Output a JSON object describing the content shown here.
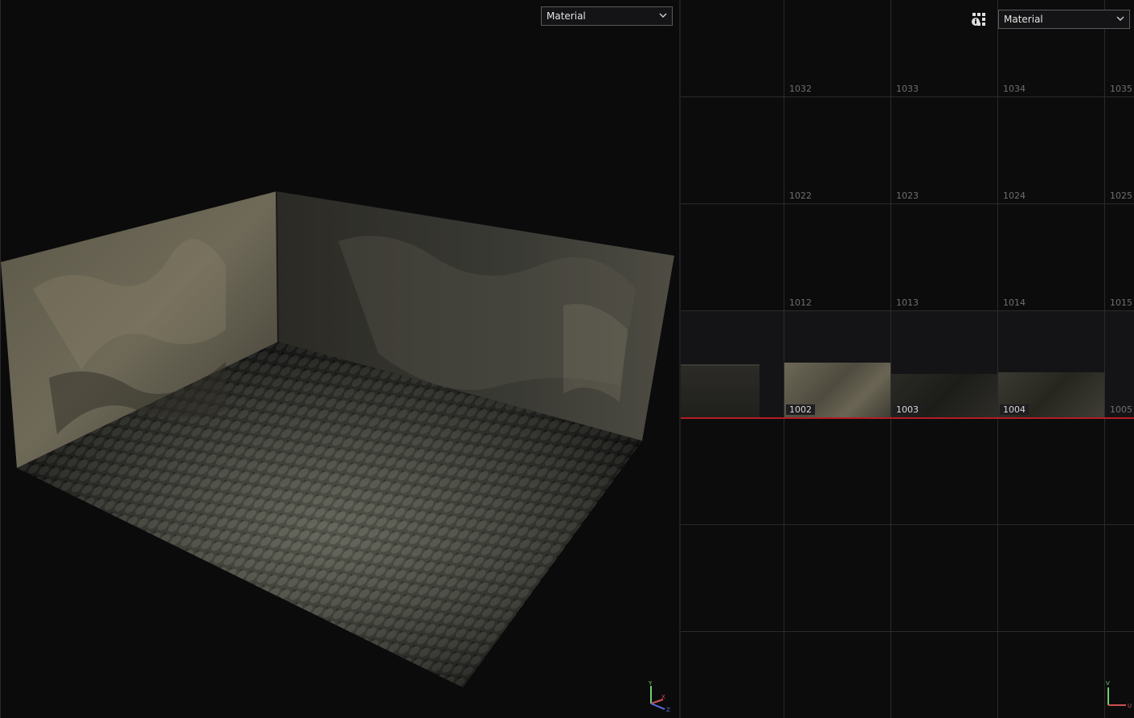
{
  "viewport3d": {
    "dropdown": {
      "selected": "Material"
    }
  },
  "viewport2d": {
    "dropdown": {
      "selected": "Material"
    },
    "settings_icon": "uv-settings-icon",
    "udim_rows": [
      [
        "1032",
        "1033",
        "1034",
        "1035"
      ],
      [
        "1022",
        "1023",
        "1024",
        "1025"
      ],
      [
        "1012",
        "1013",
        "1014",
        "1015"
      ],
      [
        "1002",
        "1003",
        "1004",
        "1005"
      ]
    ]
  },
  "axis_gizmo_3d": {
    "x": "X",
    "y": "Y",
    "z": "Z"
  },
  "axis_gizmo_2d": {
    "u": "U",
    "v": "V"
  },
  "colors": {
    "accent_red": "#b31d25",
    "panel_bg": "#0b0b0c",
    "grid": "#2b2b2e"
  }
}
